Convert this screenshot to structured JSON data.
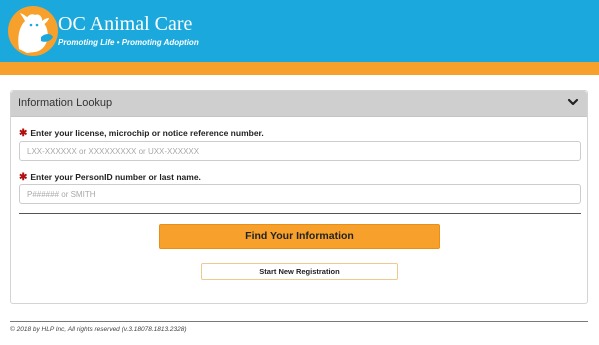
{
  "header": {
    "brand_name": "OC Animal Care",
    "tagline": "Promoting Life • Promoting Adoption",
    "bg_color": "#1ba9dd",
    "accent_color": "#f7a02c",
    "logo_icon": "dog-cat-logo-icon"
  },
  "panel": {
    "title": "Information Lookup",
    "collapse_icon": "chevron-down-icon"
  },
  "form": {
    "license_label": "Enter your license, microchip or notice reference number.",
    "license_placeholder": "LXX-XXXXXX or XXXXXXXXX or UXX-XXXXXX",
    "license_value": "",
    "person_label": "Enter your PersonID number or last name.",
    "person_placeholder": "P###### or SMITH",
    "person_value": "",
    "required_marker": "✱"
  },
  "buttons": {
    "find_label": "Find Your Information",
    "register_label": "Start New Registration"
  },
  "footer": {
    "copyright": "© 2018 by HLP Inc, All rights reserved  (v.3.18078.1813.2328)"
  }
}
